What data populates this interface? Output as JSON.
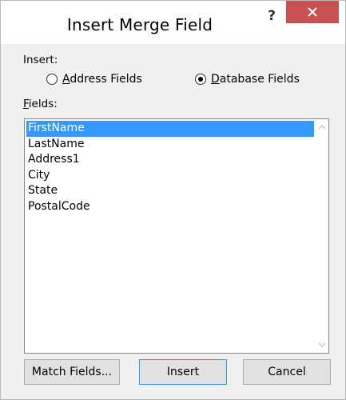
{
  "window": {
    "title": "Insert Merge Field",
    "help_glyph": "?",
    "close_glyph": "×"
  },
  "insert_group": {
    "label": "Insert:",
    "options": [
      {
        "label": "Address Fields",
        "selected": false
      },
      {
        "label": "Database Fields",
        "selected": true
      }
    ]
  },
  "fields": {
    "label": "Fields:",
    "items": [
      "FirstName",
      "LastName",
      "Address1",
      "City",
      "State",
      "PostalCode"
    ],
    "selected_index": 0
  },
  "buttons": {
    "match_fields": "Match Fields...",
    "insert": "Insert",
    "cancel": "Cancel"
  },
  "colors": {
    "selection": "#3399ff",
    "close_button": "#c75050",
    "default_button_border": "#3399ff"
  },
  "icons": {
    "close": "close-icon",
    "help": "help-icon",
    "scroll_up": "chevron-up-icon",
    "scroll_down": "chevron-down-icon"
  }
}
